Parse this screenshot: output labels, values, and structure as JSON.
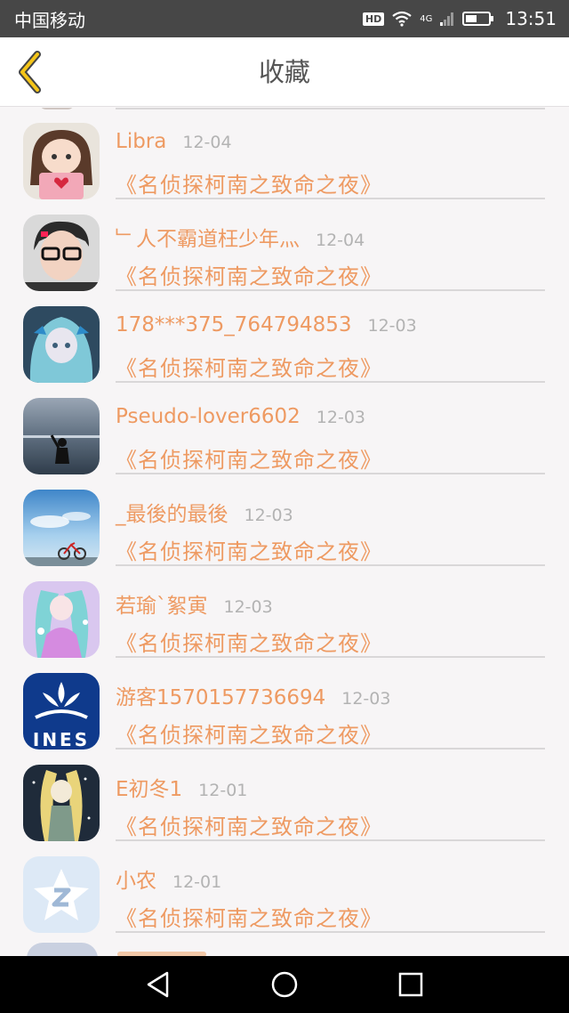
{
  "status_bar": {
    "carrier": "中国移动",
    "hd": "HD",
    "network": "4G",
    "time": "13:51"
  },
  "header": {
    "title": "收藏",
    "back_icon": "chevron-left-icon",
    "accent_color": "#f5c518"
  },
  "items": [
    {
      "username": "Libra",
      "date": "12-04",
      "movie": "《名侦探柯南之致命之夜》"
    },
    {
      "username": "﹂人不霸道枉少年灬",
      "date": "12-04",
      "movie": "《名侦探柯南之致命之夜》"
    },
    {
      "username": "178***375_764794853",
      "date": "12-03",
      "movie": "《名侦探柯南之致命之夜》"
    },
    {
      "username": "Pseudo-lover6602",
      "date": "12-03",
      "movie": "《名侦探柯南之致命之夜》"
    },
    {
      "username": "_最後的最後",
      "date": "12-03",
      "movie": "《名侦探柯南之致命之夜》"
    },
    {
      "username": "若瑜`絮寅",
      "date": "12-03",
      "movie": "《名侦探柯南之致命之夜》"
    },
    {
      "username": "游客1570157736694",
      "date": "12-03",
      "movie": "《名侦探柯南之致命之夜》"
    },
    {
      "username": "E初冬1",
      "date": "12-01",
      "movie": "《名侦探柯南之致命之夜》"
    },
    {
      "username": "小农",
      "date": "12-01",
      "movie": "《名侦探柯南之致命之夜》"
    }
  ],
  "avatar_logo_text": "INES",
  "colors": {
    "accent_orange": "#ee9a62",
    "date_gray": "#b3b3b3",
    "status_bar_bg": "#474747"
  }
}
